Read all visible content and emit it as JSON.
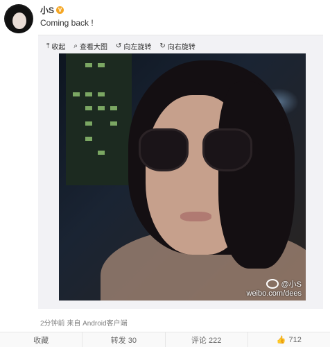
{
  "post": {
    "username": "小S",
    "vip_badge": "V",
    "text": "Coming back !",
    "meta": "2分钟前 来自 Android客户端"
  },
  "toolbar": {
    "collapse": "收起",
    "view_large": "查看大图",
    "rotate_left": "向左旋转",
    "rotate_right": "向右旋转"
  },
  "photo": {
    "watermark_handle": "@小S",
    "watermark_site": "weibo.com/dees"
  },
  "actions": {
    "favorite": "收藏",
    "repost": "转发 30",
    "comment": "评论 222",
    "like": "712"
  }
}
